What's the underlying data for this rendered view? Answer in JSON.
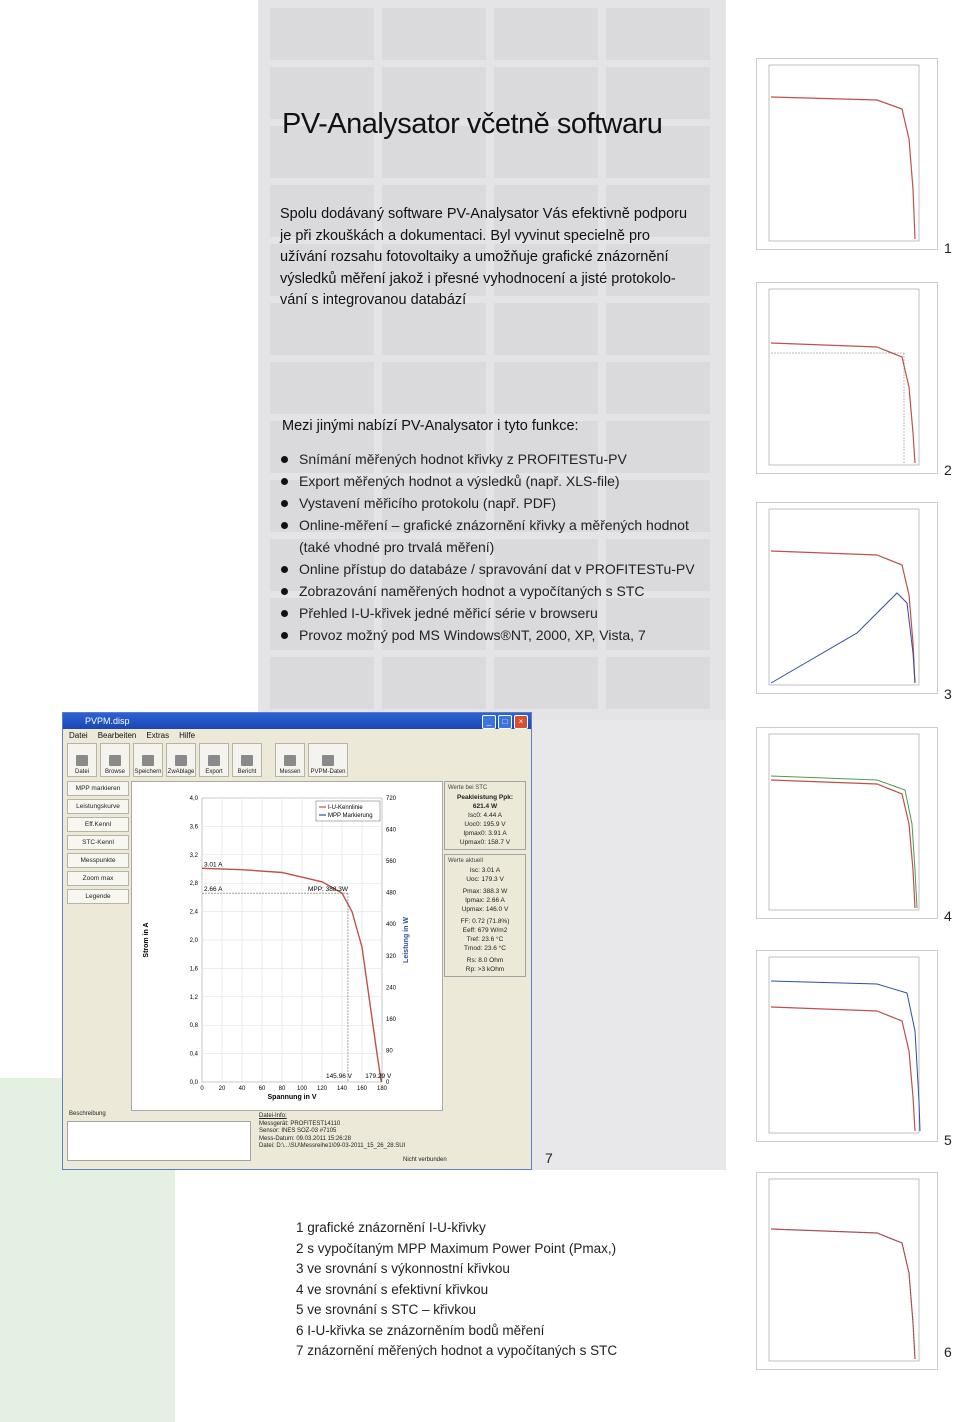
{
  "title": "PV-Analysator včetně softwaru",
  "intro_lines": [
    "Spolu dodávaný software PV-Analysator Vás efektivně podporu",
    "je při zkouškách a dokumentaci. Byl vyvinut specielně pro",
    "užívání rozsahu fotovoltaiky a umožňuje grafické znázornění",
    "výsledků měření jakož i přesné vyhodnocení a jisté protokolo-",
    "vání s integrovanou databází"
  ],
  "subhead": "Mezi jinými nabízí PV-Analysator i tyto funkce:",
  "features": [
    {
      "text": "Snímání měřených hodnot  křivky z PROFITESTu-PV",
      "bullet": true
    },
    {
      "text": "Export měřených hodnot a výsledků (např. XLS-file)",
      "bullet": true
    },
    {
      "text": "Vystavení měřicího protokolu (např. PDF)",
      "bullet": true
    },
    {
      "text": "Online-měření – grafické znázornění křivky a měřených hodnot",
      "bullet": true
    },
    {
      "text": "(také vhodné pro trvalá měření)",
      "bullet": false
    },
    {
      "text": "Online přístup do databáze / spravování dat v PROFITESTu-PV",
      "bullet": true
    },
    {
      "text": "Zobrazování naměřených hodnot a vypočítaných s STC",
      "bullet": true
    },
    {
      "text": "Přehled I-U-křivek jedné měřicí série v browseru",
      "bullet": true
    },
    {
      "text": "Provoz možný pod MS Windows®NT, 2000, XP, Vista, 7",
      "bullet": true
    }
  ],
  "side_chart_numbers": [
    "1",
    "2",
    "3",
    "4",
    "5",
    "6"
  ],
  "screenshot_number": "7",
  "captions": [
    "1  grafické znázornění I-U-křivky",
    "2  s vypočítaným MPP Maximum Power Point (Pmax,)",
    "3  ve srovnání s výkonnostní křivkou",
    "4  ve srovnání s efektivní křivkou",
    "5  ve srovnání s STC – křivkou",
    "6  I-U-křivka se znázorněním bodů měření",
    "7  znázornění měřených hodnot a vypočítaných s STC"
  ],
  "app": {
    "window_title": "PVPM.disp",
    "menu": [
      "Datei",
      "Bearbeiten",
      "Extras",
      "Hilfe"
    ],
    "toolbar": [
      "Datei",
      "Browse",
      "Speichern",
      "ZwAblage",
      "Export",
      "Bericht",
      "Messen",
      "PVPM-Daten"
    ],
    "sidebar": [
      "MPP markieren",
      "Leistungskurve",
      "Eff.Kennl",
      "STC-Kennl",
      "Messpunkte",
      "Zoom max",
      "Legende"
    ],
    "legend": [
      "I-U-Kennlinie",
      "MPP Markierung"
    ],
    "x_axis_label": "Spannung in V",
    "y_axis_label": "Strom in A",
    "y2_axis_label": "Leistung in W",
    "x_ticks": [
      "0",
      "20",
      "40",
      "60",
      "80",
      "100",
      "120",
      "140",
      "160",
      "180"
    ],
    "y_ticks": [
      "0,0",
      "0,4",
      "0,8",
      "1,2",
      "1,6",
      "2,0",
      "2,4",
      "2,8",
      "3,2",
      "3,6",
      "4,0"
    ],
    "y2_ticks": [
      "0",
      "80",
      "160",
      "240",
      "320",
      "400",
      "480",
      "560",
      "640",
      "720"
    ],
    "annotations": [
      "3.01 A",
      "2.66 A",
      "MPP: 388.3W",
      "145.96 V",
      "179.29 V"
    ],
    "stc_box_title": "Werte bei STC",
    "stc_values": [
      "Peakleistung Ppk:",
      "621.4 W",
      "Isc0: 4.44 A",
      "Uoc0: 195.9 V",
      "Ipmax0: 3.91 A",
      "Upmax0: 158.7 V"
    ],
    "actual_box_title": "Werte aktuell",
    "actual_values": [
      "Isc: 3.01 A",
      "Uoc: 179.3 V",
      "Pmax: 388.3 W",
      "Ipmax: 2.66 A",
      "Upmax: 146.0 V",
      "FF: 0.72 (71.8%)",
      "Eeff: 679 W/m2",
      "Tref: 23.6 °C",
      "Tmod: 23.6 °C",
      "Rs: 8.0 Ohm",
      "Rp: >3 kOhm"
    ],
    "description_label": "Beschreibung",
    "data_info": [
      "Datei-Info:",
      "Messgerät: PROFITEST14110",
      "Sensor: INES SOZ-03 #7105",
      "Mess-Datum: 09.03.2011  15:26:28",
      "Datei: D:\\...\\SU\\Messreihe1\\09-03-2011_15_26_28.SUI"
    ],
    "status": "Nicht verbunden"
  },
  "chart_data": [
    {
      "type": "line",
      "title": "",
      "xlabel": "Spannung in V",
      "ylabel": "Strom in A",
      "y2label": "Leistung in W",
      "xlim": [
        0,
        180
      ],
      "ylim": [
        0,
        4.0
      ],
      "y2lim": [
        0,
        720
      ],
      "series": [
        {
          "name": "I-U-Kennlinie",
          "x": [
            0,
            40,
            80,
            120,
            140,
            150,
            160,
            165,
            170,
            175,
            179.29
          ],
          "y": [
            3.01,
            2.99,
            2.95,
            2.82,
            2.66,
            2.4,
            1.9,
            1.4,
            0.9,
            0.4,
            0.0
          ]
        }
      ],
      "mpp": {
        "label": "MPP: 388.3W",
        "x": 145.96,
        "y": 2.66
      },
      "legend_position": "top-right"
    }
  ]
}
